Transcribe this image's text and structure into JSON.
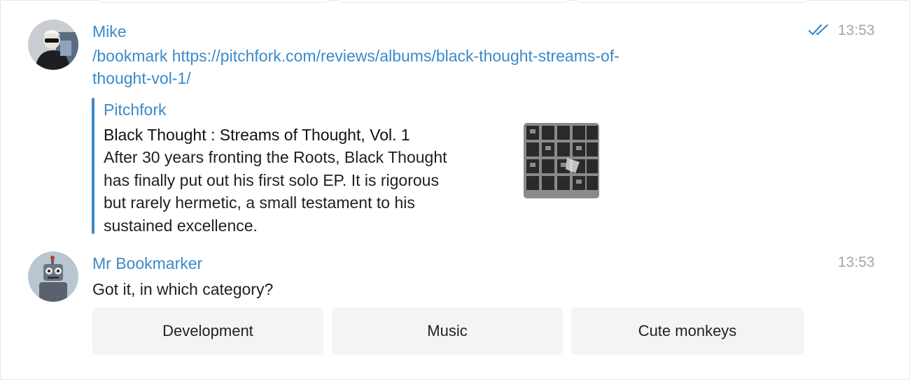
{
  "messages": [
    {
      "sender": "Mike",
      "time": "13:53",
      "read_icon": "double-check-icon",
      "text_line1": "/bookmark https://pitchfork.com/reviews/albums/black-thought-streams-of-",
      "text_line2": "thought-vol-1/",
      "preview": {
        "site": "Pitchfork",
        "title": "Black Thought : Streams of Thought, Vol. 1",
        "desc_lines": [
          "After 30 years fronting the Roots, Black Thought",
          "has finally put out his first solo EP. It is rigorous",
          "but rarely hermetic, a small testament to his",
          "sustained excellence."
        ]
      }
    },
    {
      "sender": "Mr Bookmarker",
      "time": "13:53",
      "text": "Got it, in which category?"
    }
  ],
  "keyboard": {
    "buttons": [
      "Development",
      "Music",
      "Cute monkeys"
    ]
  },
  "colors": {
    "accent": "#3a8ac9",
    "time": "#a0a6ad",
    "button_bg": "#f3f4f5"
  }
}
